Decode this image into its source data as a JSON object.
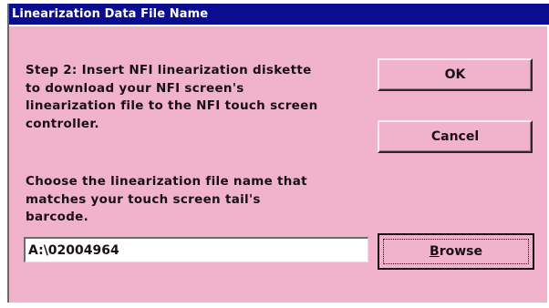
{
  "window": {
    "title": "Linearization Data File Name"
  },
  "instructions": {
    "step_lines": [
      "Step 2:  Insert NFI linearization diskette",
      "to download your NFI screen's",
      "linearization file to the NFI touch screen",
      "controller."
    ],
    "choose_lines": [
      "Choose the linearization file name that",
      "matches your touch screen tail's",
      "barcode."
    ]
  },
  "file_input": {
    "value": "A:\\02004964"
  },
  "buttons": {
    "ok": "OK",
    "cancel": "Cancel",
    "browse_mnemonic": "B",
    "browse_rest": "rowse"
  },
  "colors": {
    "title_bar": "#0a0d8f",
    "dialog_background": "#f0b3cb",
    "text": "#1a1013"
  }
}
